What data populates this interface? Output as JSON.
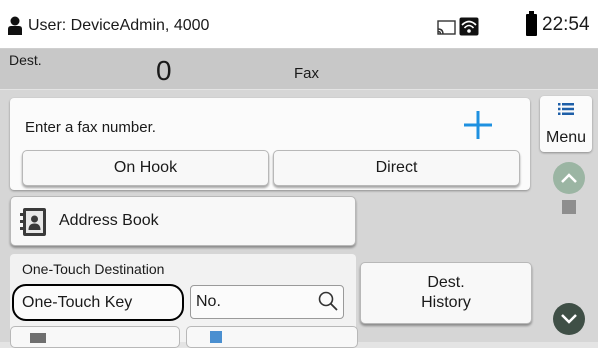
{
  "status_bar": {
    "user_text": "User: DeviceAdmin, 4000",
    "time": "22:54",
    "icons": [
      "user-icon",
      "cast-icon",
      "wifi-icon",
      "battery-icon"
    ]
  },
  "dest_bar": {
    "dest_label": "Dest.",
    "dest_count": "0",
    "mode": "Fax"
  },
  "fax_entry": {
    "placeholder": "Enter a fax number.",
    "add_icon": "plus-icon",
    "on_hook_label": "On Hook",
    "direct_label": "Direct"
  },
  "address_book": {
    "label": "Address Book",
    "icon": "address-book-icon"
  },
  "one_touch": {
    "title": "One-Touch Destination",
    "key_label": "One-Touch Key",
    "number_placeholder": "No.",
    "search_icon": "search-icon"
  },
  "dest_history": {
    "line1": "Dest.",
    "line2": "History"
  },
  "menu": {
    "label": "Menu",
    "icon": "menu-icon"
  },
  "colors": {
    "status_bg": "#ffffff",
    "dest_bar_bg": "#c8c8c8",
    "panel_bg": "#d6d6d6",
    "accent_blue": "#1e90e0",
    "scroll_up": "#9bb5a3",
    "scroll_down": "#3f4f46"
  }
}
